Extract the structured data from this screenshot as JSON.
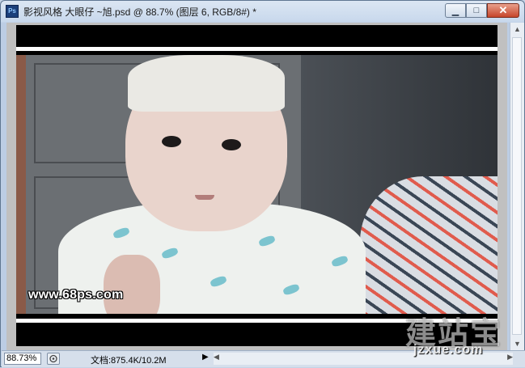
{
  "window": {
    "app_icon": "photoshop-icon",
    "app_icon_text": "Ps",
    "title": "影视风格 大眼仔 ~旭.psd @ 88.7% (图层 6, RGB/8#) *"
  },
  "window_controls": {
    "minimize_icon": "minimize-icon",
    "maximize_icon": "maximize-icon",
    "close_icon": "close-icon"
  },
  "image_overlay": {
    "site_watermark": "www.68ps.com"
  },
  "status": {
    "zoom": "88.73%",
    "doc_info": "文档:875.4K/10.2M"
  },
  "page_watermark": {
    "logo_text": "建站宝",
    "url_text": "jzxue.com"
  },
  "colors": {
    "title_bar": "#c8d8ec",
    "close_button": "#c6452a",
    "canvas_bg": "#c0c0c0",
    "letterbox": "#000000"
  }
}
